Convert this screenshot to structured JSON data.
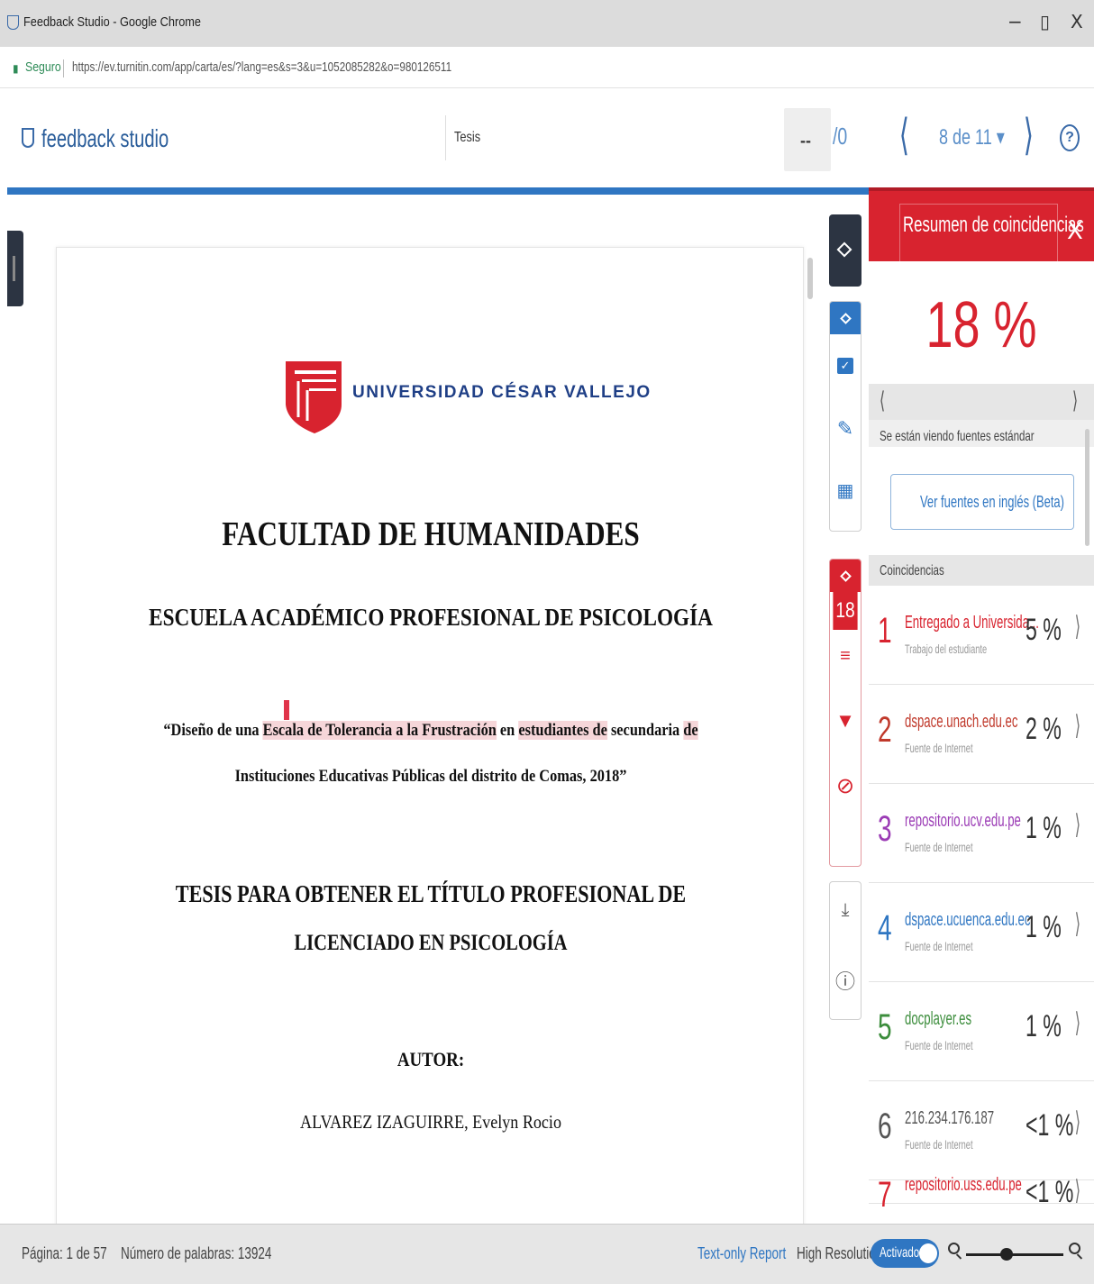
{
  "browser": {
    "window_title": "Feedback Studio - Google Chrome",
    "secure_label": "Seguro",
    "url": "https://ev.turnitin.com/app/carta/es/?lang=es&s=3&u=1052085282&o=980126511",
    "controls": [
      "−",
      "▯",
      "X"
    ]
  },
  "app": {
    "logo_text": "feedback studio",
    "doc_title": "Tesis",
    "page_input": "--",
    "page_total": "/0",
    "paper_selector": "8 de 11 ▾",
    "help_label": "?"
  },
  "document": {
    "university": "UNIVERSIDAD CÉSAR VALLEJO",
    "faculty": "FACULTAD DE HUMANIDADES",
    "school": "ESCUELA ACADÉMICO PROFESIONAL DE PSICOLOGÍA",
    "thesis_title": {
      "p1": "“Diseño de una ",
      "h1": "Escala de Tolerancia a la Frustración",
      "p2": " en ",
      "h2": "estudiantes de",
      "p3": " secundaria ",
      "h3": "de",
      "line2": "Instituciones Educativas Públicas del distrito de Comas, 2018”"
    },
    "degree_line1": "TESIS PARA OBTENER EL TÍTULO PROFESIONAL DE",
    "degree_line2": "LICENCIADO EN PSICOLOGÍA",
    "author_label": "AUTOR:",
    "author": "ALVAREZ IZAGUIRRE, Evelyn Rocio"
  },
  "toolbar": {
    "similarity_score": "18"
  },
  "panel": {
    "title": "Resumen de coincidencias",
    "close": "X",
    "overall_percent": "18 %",
    "viewing_text": "Se están viendo fuentes estándar",
    "english_button": "Ver fuentes en inglés (Beta)",
    "matches_header": "Coincidencias",
    "matches": [
      {
        "num": "1",
        "source": "Entregado a Universida...",
        "type": "Trabajo del estudiante",
        "percent": "5 %",
        "color": "#d8232f"
      },
      {
        "num": "2",
        "source": "dspace.unach.edu.ec",
        "type": "Fuente de Internet",
        "percent": "2 %",
        "color": "#c0392b"
      },
      {
        "num": "3",
        "source": "repositorio.ucv.edu.pe",
        "type": "Fuente de Internet",
        "percent": "1 %",
        "color": "#9b3bb5"
      },
      {
        "num": "4",
        "source": "dspace.ucuenca.edu.ec",
        "type": "Fuente de Internet",
        "percent": "1 %",
        "color": "#2f76c2"
      },
      {
        "num": "5",
        "source": "docplayer.es",
        "type": "Fuente de Internet",
        "percent": "1 %",
        "color": "#3c8d3c"
      },
      {
        "num": "6",
        "source": "216.234.176.187",
        "type": "Fuente de Internet",
        "percent": "<1 %",
        "color": "#555555"
      },
      {
        "num": "7",
        "source": "repositorio.uss.edu.pe",
        "type": "",
        "percent": "<1 %",
        "color": "#d8232f"
      }
    ]
  },
  "status": {
    "page": "Página: 1 de 57",
    "word_count": "Número de palabras: 13924",
    "text_only": "Text-only Report",
    "high_res": "High Resolution",
    "toggle": "Activado"
  }
}
